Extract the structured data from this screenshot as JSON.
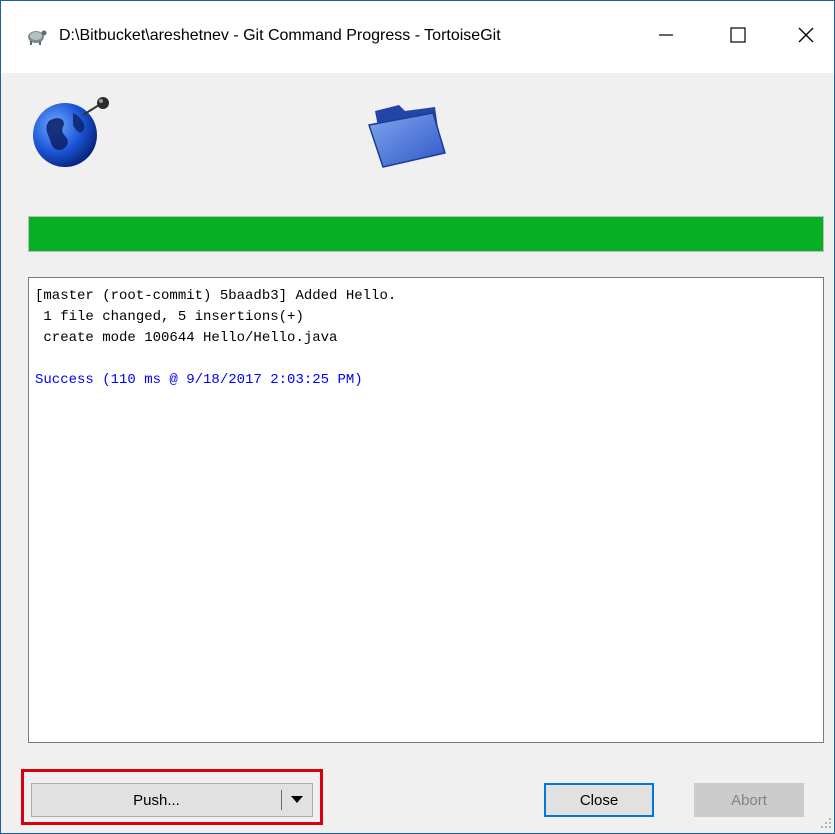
{
  "window": {
    "title": "D:\\Bitbucket\\areshetnev - Git Command Progress - TortoiseGit",
    "icons": {
      "app": "tortoise-icon",
      "minimize": "minimize-icon",
      "maximize": "maximize-icon",
      "close": "close-icon"
    }
  },
  "header": {
    "left_icon": "globe-network-icon",
    "right_icon": "folder-icon"
  },
  "progress": {
    "percent": 100,
    "color": "#06b025"
  },
  "log": {
    "lines": [
      "[master (root-commit) 5baadb3] Added Hello.",
      " 1 file changed, 5 insertions(+)",
      " create mode 100644 Hello/Hello.java"
    ],
    "status": "Success (110 ms @ 9/18/2017 2:03:25 PM)",
    "status_color": "#0000ff"
  },
  "buttons": {
    "push_label": "Push...",
    "close_label": "Close",
    "abort_label": "Abort"
  },
  "highlight_color": "#d8000c"
}
